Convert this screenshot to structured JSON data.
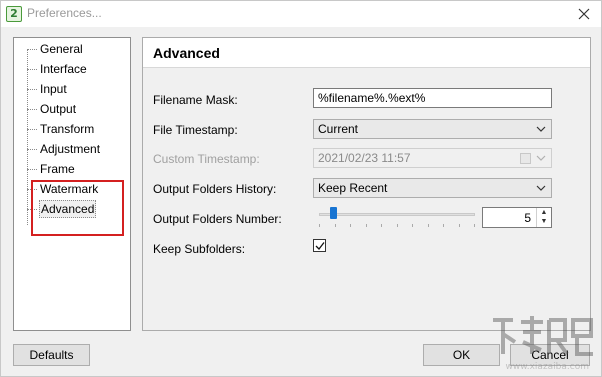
{
  "window": {
    "title": "Preferences...",
    "app_icon_text": "2",
    "close_icon": "close-icon"
  },
  "sidebar": {
    "items": [
      {
        "label": "General"
      },
      {
        "label": "Interface"
      },
      {
        "label": "Input"
      },
      {
        "label": "Output"
      },
      {
        "label": "Transform"
      },
      {
        "label": "Adjustment"
      },
      {
        "label": "Frame"
      },
      {
        "label": "Watermark"
      },
      {
        "label": "Advanced",
        "selected": true
      }
    ],
    "highlight_color": "#d42020"
  },
  "advanced": {
    "title": "Advanced",
    "filename_mask": {
      "label": "Filename Mask:",
      "value": "%filename%.%ext%"
    },
    "file_timestamp": {
      "label": "File Timestamp:",
      "value": "Current"
    },
    "custom_timestamp": {
      "label": "Custom Timestamp:",
      "value": "2021/02/23 11:57",
      "disabled": true
    },
    "output_folders_history": {
      "label": "Output Folders History:",
      "value": "Keep Recent"
    },
    "output_folders_number": {
      "label": "Output Folders Number:",
      "value": "5",
      "slider_fraction": 0.08
    },
    "keep_subfolders": {
      "label": "Keep Subfolders:",
      "checked": true
    }
  },
  "buttons": {
    "defaults": "Defaults",
    "ok": "OK",
    "cancel": "Cancel"
  },
  "watermark": {
    "url": "www.xiazaiba.com"
  },
  "colors": {
    "accent": "#1874d2",
    "window_bg": "#f0f0f0"
  }
}
